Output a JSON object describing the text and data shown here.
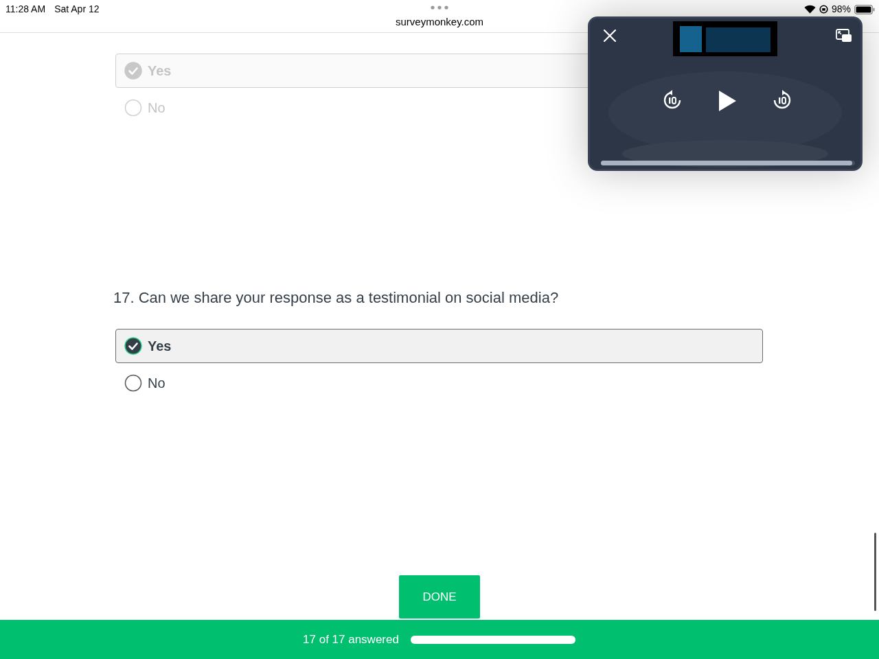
{
  "status_bar": {
    "time": "11:28 AM",
    "date": "Sat Apr 12",
    "battery": "98%"
  },
  "address_bar": {
    "url": "surveymonkey.com"
  },
  "questions": [
    {
      "dimmed": true,
      "options": [
        {
          "label": "Yes",
          "selected": true
        },
        {
          "label": "No",
          "selected": false
        }
      ]
    },
    {
      "dimmed": false,
      "title": "17. Can we share your response as a testimonial on social media?",
      "options": [
        {
          "label": "Yes",
          "selected": true
        },
        {
          "label": "No",
          "selected": false
        }
      ]
    }
  ],
  "done_button": "DONE",
  "footer": {
    "label": "17 of 17 answered",
    "level": 1
  },
  "video_overlay": {
    "kind": "picture",
    "scrubber": {
      "level": 0.99
    }
  }
}
